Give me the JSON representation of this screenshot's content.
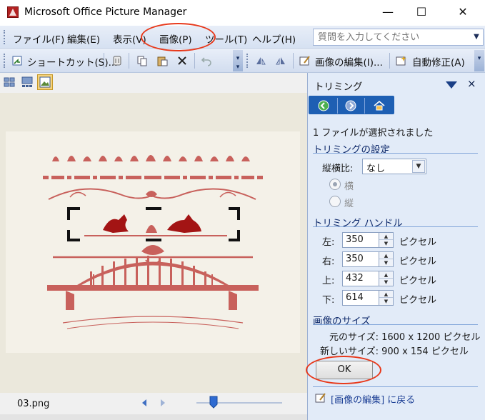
{
  "window": {
    "title": "Microsoft Office Picture Manager",
    "minimize": "—",
    "maximize": "☐",
    "close": "✕"
  },
  "menu": {
    "items": [
      "ファイル(F)",
      "編集(E)",
      "表示(V)",
      "画像(P)",
      "ツール(T)",
      "ヘルプ(H)"
    ],
    "help_placeholder": "質問を入力してください"
  },
  "toolbar": {
    "shortcut_label": "ショートカット(S)...",
    "edit_image_label": "画像の編集(I)...",
    "auto_correct_label": "自動修正(A)"
  },
  "status": {
    "filename": "03.png",
    "zoom_fraction": 0.2
  },
  "pane": {
    "title": "トリミング",
    "selected_info": "1 ファイルが選択されました",
    "crop_settings_heading": "トリミングの設定",
    "aspect_ratio_label": "縦横比:",
    "aspect_ratio_value": "なし",
    "landscape_label": "横",
    "portrait_label": "縦",
    "handles_heading": "トリミング ハンドル",
    "handles": [
      {
        "label": "左:",
        "value": "350",
        "unit": "ピクセル"
      },
      {
        "label": "右:",
        "value": "350",
        "unit": "ピクセル"
      },
      {
        "label": "上:",
        "value": "432",
        "unit": "ピクセル"
      },
      {
        "label": "下:",
        "value": "614",
        "unit": "ピクセル"
      }
    ],
    "size_heading": "画像のサイズ",
    "original_size": "元のサイズ:  1600 x 1200 ピクセル",
    "new_size": "新しいサイズ:  900 x 154 ピクセル",
    "ok_label": "OK",
    "back_link": "[画像の編集] に戻る"
  },
  "colors": {
    "accent_red": "#e8391b",
    "ornament": "#c8615c",
    "pane_bg": "#e2ebf8",
    "pane_nav": "#1e5fb3"
  }
}
